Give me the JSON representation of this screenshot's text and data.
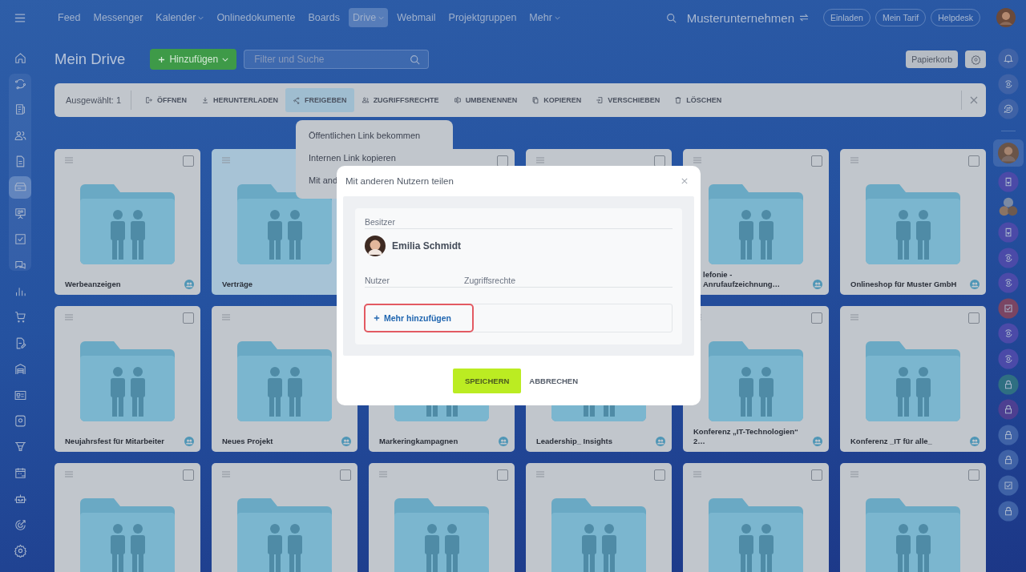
{
  "top_bar": {
    "nav": [
      {
        "label": "Feed",
        "selected": false,
        "has_menu": false
      },
      {
        "label": "Messenger",
        "selected": false,
        "has_menu": false
      },
      {
        "label": "Kalender",
        "selected": false,
        "has_menu": true
      },
      {
        "label": "Onlinedokumente",
        "selected": false,
        "has_menu": false
      },
      {
        "label": "Boards",
        "selected": false,
        "has_menu": false
      },
      {
        "label": "Drive",
        "selected": true,
        "has_menu": true
      },
      {
        "label": "Webmail",
        "selected": false,
        "has_menu": false
      },
      {
        "label": "Projektgruppen",
        "selected": false,
        "has_menu": false
      },
      {
        "label": "Mehr",
        "selected": false,
        "has_menu": true
      }
    ],
    "company": "Musterunternehmen",
    "buttons": [
      "Einladen",
      "Mein Tarif",
      "Helpdesk"
    ]
  },
  "left_sidebar": {
    "items": [
      {
        "selected": false
      },
      {
        "selected": false
      },
      {
        "selected": false
      },
      {
        "selected": false
      },
      {
        "selected": false
      },
      {
        "selected": true
      },
      {
        "selected": false
      },
      {
        "selected": false
      },
      {
        "selected": false
      },
      {
        "selected": false
      },
      {
        "selected": false
      },
      {
        "selected": false
      },
      {
        "selected": false
      },
      {
        "selected": false
      },
      {
        "selected": false
      },
      {
        "selected": false
      },
      {
        "selected": false
      },
      {
        "selected": false
      },
      {
        "selected": false
      },
      {
        "selected": false
      }
    ]
  },
  "header": {
    "title": "Mein Drive",
    "add_button": "Hinzufügen",
    "search": {
      "placeholder": "Filter und Suche"
    },
    "trash_button": "Papierkorb"
  },
  "toolbar": {
    "selection": "Ausgewählt: 1",
    "actions": [
      {
        "label": "ÖFFNEN",
        "selected": false
      },
      {
        "label": "HERUNTERLADEN",
        "selected": false
      },
      {
        "label": "FREIGEBEN",
        "selected": true
      },
      {
        "label": "ZUGRIFFSRECHTE",
        "selected": false
      },
      {
        "label": "UMBENENNEN",
        "selected": false
      },
      {
        "label": "KOPIEREN",
        "selected": false
      },
      {
        "label": "VERSCHIEBEN",
        "selected": false
      },
      {
        "label": "LÖSCHEN",
        "selected": false
      }
    ]
  },
  "share_menu": {
    "items": [
      "Öffentlichen Link bekommen",
      "Internen Link kopieren",
      "Mit and"
    ]
  },
  "grid": {
    "cards": [
      {
        "name": "Werbeanzeigen",
        "kind": "full",
        "shared": true,
        "selected": false
      },
      {
        "name": "Verträge",
        "kind": "full",
        "shared": false,
        "selected": true
      },
      {
        "kind": "covered",
        "selected": false
      },
      {
        "kind": "covered",
        "selected": false
      },
      {
        "name": "lefonie - Anrufaufzeichnung…",
        "kind": "clipped",
        "shared": true,
        "selected": false
      },
      {
        "name": "Onlineshop für Muster GmbH",
        "kind": "full",
        "shared": true,
        "selected": false
      },
      {
        "name": "Neujahrsfest für Mitarbeiter",
        "kind": "full",
        "shared": true,
        "selected": false
      },
      {
        "name": "Neues Projekt",
        "kind": "full",
        "shared": true,
        "selected": false
      },
      {
        "name": "Markeringkampagnen",
        "kind": "full",
        "shared": true,
        "selected": false
      },
      {
        "name": "Leadership_ Insights",
        "kind": "full",
        "shared": true,
        "selected": false
      },
      {
        "name": "Konferenz „IT-Technologien“ 2…",
        "kind": "full",
        "shared": true,
        "selected": false
      },
      {
        "name": "Konferenz _IT für alle_",
        "kind": "full",
        "shared": true,
        "selected": false
      },
      {
        "kind": "cut",
        "selected": false
      },
      {
        "kind": "cut",
        "selected": false
      },
      {
        "kind": "cut",
        "selected": false
      },
      {
        "kind": "cut",
        "selected": false
      },
      {
        "kind": "cut",
        "selected": false
      },
      {
        "kind": "cut",
        "selected": false
      }
    ]
  },
  "dialog": {
    "title": "Mit anderen Nutzern teilen",
    "owner_label": "Besitzer",
    "owner": "Emilia Schmidt",
    "columns": [
      "Nutzer",
      "Zugriffsrechte"
    ],
    "add_link": "Mehr hinzufügen",
    "buttons": [
      "SPEICHERN",
      "ABBRECHEN"
    ]
  }
}
